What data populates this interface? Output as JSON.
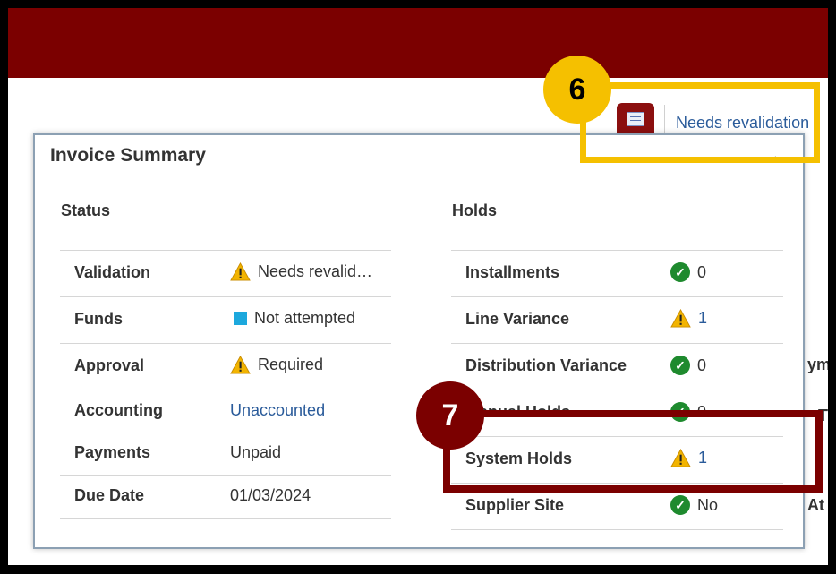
{
  "header": {
    "status_link": "Needs revalidation"
  },
  "panel": {
    "title": "Invoice Summary",
    "status": {
      "heading": "Status",
      "rows": [
        {
          "label": "Validation",
          "value": "Needs revalid…",
          "icon": "warning-icon"
        },
        {
          "label": "Funds",
          "value": "Not attempted",
          "icon": "square-icon"
        },
        {
          "label": "Approval",
          "value": "Required",
          "icon": "warning-icon"
        },
        {
          "label": "Accounting",
          "value": "Unaccounted"
        },
        {
          "label": "Payments",
          "value": "Unpaid"
        },
        {
          "label": "Due Date",
          "value": "01/03/2024"
        }
      ]
    },
    "holds": {
      "heading": "Holds",
      "rows": [
        {
          "label": "Installments",
          "value": "0",
          "icon": "check-icon"
        },
        {
          "label": "Line Variance",
          "value": "1",
          "icon": "warning-icon"
        },
        {
          "label": "Distribution Variance",
          "value": "0",
          "icon": "check-icon"
        },
        {
          "label": "Manual Holds",
          "value": "0",
          "icon": "check-icon"
        },
        {
          "label": "System Holds",
          "value": "1",
          "icon": "warning-icon"
        },
        {
          "label": "Supplier Site",
          "value": "No",
          "icon": "check-icon"
        }
      ]
    }
  },
  "side_fragments": [
    "ym",
    "T",
    "At"
  ],
  "callouts": {
    "six": "6",
    "seven": "7"
  },
  "colors": {
    "brand": "#7b0000",
    "callout_6": "#f5c000",
    "link": "#2a5b9a",
    "ok": "#1e8a2e",
    "warn": "#f2b400"
  }
}
